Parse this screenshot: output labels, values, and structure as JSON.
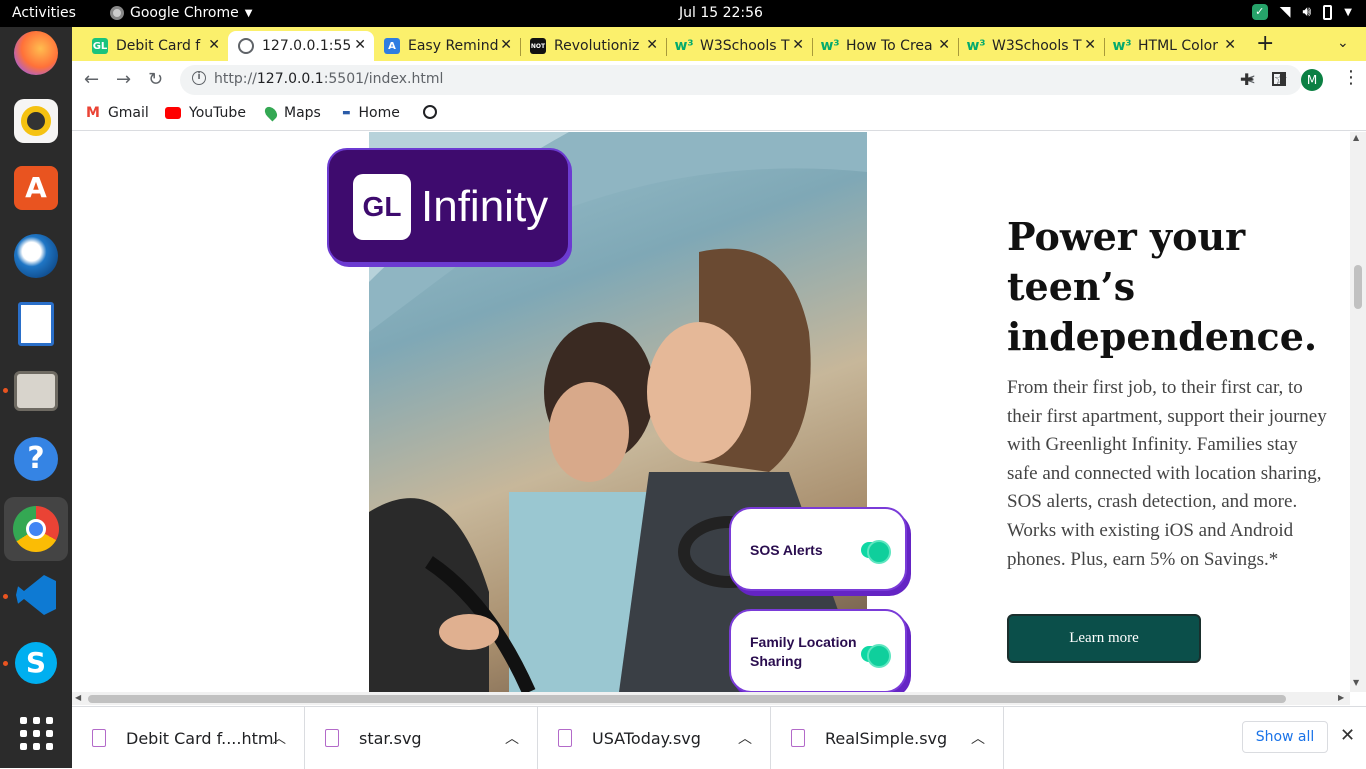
{
  "system": {
    "activities": "Activities",
    "app_name": "Google Chrome",
    "clock": "Jul 15  22:56"
  },
  "tabs": [
    {
      "title": "Debit Card f",
      "favicon": "GL",
      "color": "#19c37d",
      "active": false
    },
    {
      "title": "127.0.0.1:55",
      "favicon": "globe",
      "color": "#5f6368",
      "active": true
    },
    {
      "title": "Easy Remind",
      "favicon": "A",
      "color": "#2f7de1",
      "active": false
    },
    {
      "title": "Revolutioniz",
      "favicon": "NOT",
      "color": "#111111",
      "active": false
    },
    {
      "title": "W3Schools T",
      "favicon": "w3",
      "color": "#04aa6d",
      "active": false
    },
    {
      "title": "How To Crea",
      "favicon": "w3",
      "color": "#04aa6d",
      "active": false
    },
    {
      "title": "W3Schools T",
      "favicon": "w3",
      "color": "#04aa6d",
      "active": false
    },
    {
      "title": "HTML Color",
      "favicon": "w3",
      "color": "#04aa6d",
      "active": false
    }
  ],
  "toolbar": {
    "url_prefix": "http://",
    "url_host": "127.0.0.1",
    "url_rest": ":5501/index.html",
    "profile_initial": "M"
  },
  "bookmarks": [
    {
      "label": "Gmail",
      "icon": "gmail-icon"
    },
    {
      "label": "YouTube",
      "icon": "youtube-icon"
    },
    {
      "label": "Maps",
      "icon": "maps-icon"
    },
    {
      "label": "Home",
      "icon": "home-icon"
    }
  ],
  "hero": {
    "logo_mark": "GL",
    "logo_name": "Infinity",
    "sos_label": "SOS Alerts",
    "family_label_1": "Family Location",
    "family_label_2": "Sharing",
    "title": "Power your teen’s independence.",
    "body": "From their first job, to their first car, to their first apartment, support their journey with Greenlight Infinity. Families stay safe and connected with location sharing, SOS alerts, crash detection, and more. Works with existing iOS and Android phones. Plus, earn 5% on Savings.*",
    "cta": "Learn more"
  },
  "downloads": [
    {
      "name": "Debit Card f....html"
    },
    {
      "name": "star.svg"
    },
    {
      "name": "USAToday.svg"
    },
    {
      "name": "RealSimple.svg"
    }
  ],
  "show_all": "Show all",
  "colors": {
    "tabstrip": "#fbf06c",
    "brand_purple": "#3e0b6e",
    "toggle_green": "#0fd8a4",
    "cta_teal": "#0b4f4a"
  }
}
